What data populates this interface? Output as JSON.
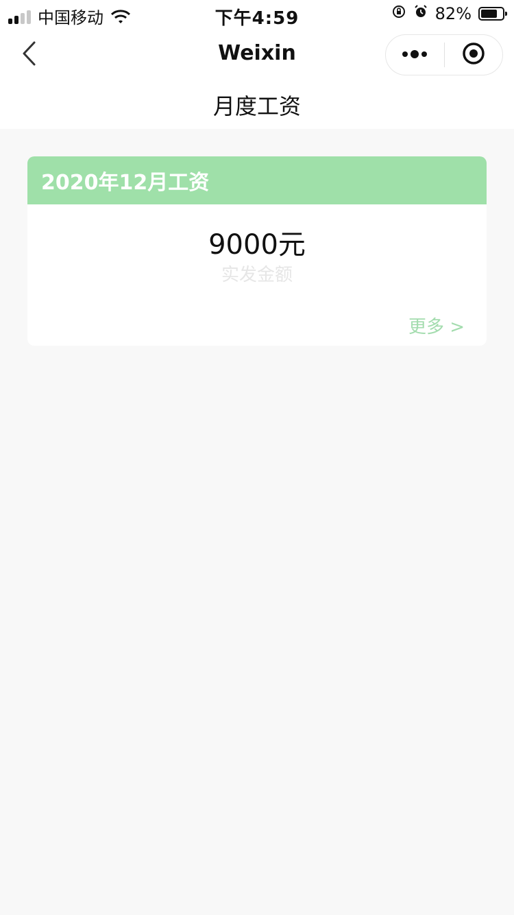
{
  "status_bar": {
    "carrier": "中国移动",
    "time": "下午4:59",
    "battery_percent": "82%",
    "battery_level": 0.82,
    "icons": [
      "signal-icon",
      "wifi-icon",
      "orientation-lock-icon",
      "alarm-icon",
      "battery-icon"
    ]
  },
  "nav": {
    "title": "Weixin",
    "icons": [
      "back-chevron-icon",
      "more-dots-icon",
      "close-target-icon"
    ]
  },
  "page": {
    "title": "月度工资"
  },
  "salary_card": {
    "header": "2020年12月工资",
    "amount": "9000元",
    "amount_label": "实发金额",
    "more_link": "更多 >"
  },
  "colors": {
    "background": "#f8f8f8",
    "card_header": "#9fe0a9",
    "more_link": "#a3dcae",
    "amount_label": "#e6e6e6"
  }
}
